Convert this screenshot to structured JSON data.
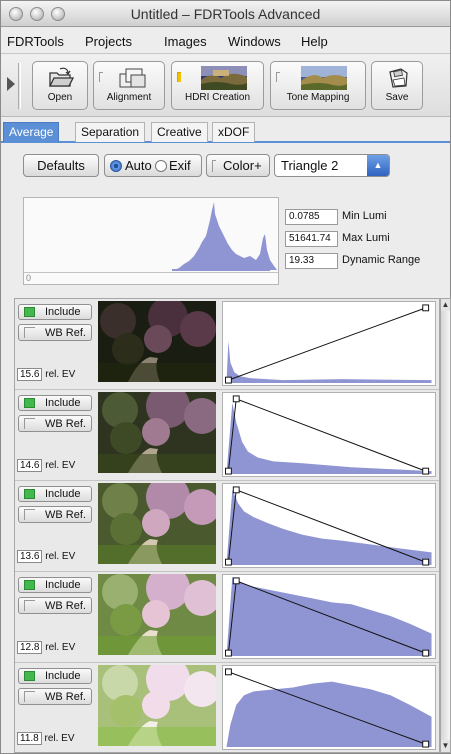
{
  "window": {
    "title": "Untitled – FDRTools Advanced"
  },
  "menu": [
    {
      "label": "FDRTools"
    },
    {
      "label": "Projects"
    },
    {
      "label": "Images"
    },
    {
      "label": "Windows"
    },
    {
      "label": "Help"
    }
  ],
  "toolbar": {
    "open": "Open",
    "alignment": "Alignment",
    "hdri": "HDRI Creation",
    "tone": "Tone Mapping",
    "save": "Save"
  },
  "tabs": [
    {
      "label": "Average",
      "active": true
    },
    {
      "label": "Separation"
    },
    {
      "label": "Creative"
    },
    {
      "label": "xDOF"
    }
  ],
  "options": {
    "defaults": "Defaults",
    "auto": "Auto",
    "exif": "Exif",
    "color_plus": "Color+",
    "weighting": "Triangle 2"
  },
  "stats": {
    "min_lumi_value": "0.0785",
    "min_lumi_label": "Min Lumi",
    "max_lumi_value": "51641.74",
    "max_lumi_label": "Max Lumi",
    "dr_value": "19.33",
    "dr_label": "Dynamic Range",
    "slider_min": "0"
  },
  "images": [
    {
      "include": "Include",
      "wb": "WB Ref.",
      "ev": "15.6",
      "ev_unit": "rel. EV"
    },
    {
      "include": "Include",
      "wb": "WB Ref.",
      "ev": "14.6",
      "ev_unit": "rel. EV"
    },
    {
      "include": "Include",
      "wb": "WB Ref.",
      "ev": "13.6",
      "ev_unit": "rel. EV"
    },
    {
      "include": "Include",
      "wb": "WB Ref.",
      "ev": "12.8",
      "ev_unit": "rel. EV"
    },
    {
      "include": "Include",
      "wb": "WB Ref.",
      "ev": "11.8",
      "ev_unit": "rel. EV"
    }
  ],
  "colors": {
    "accent": "#5b8fd6",
    "histogram": "#8f95d2",
    "include_led": "#43b84d"
  }
}
